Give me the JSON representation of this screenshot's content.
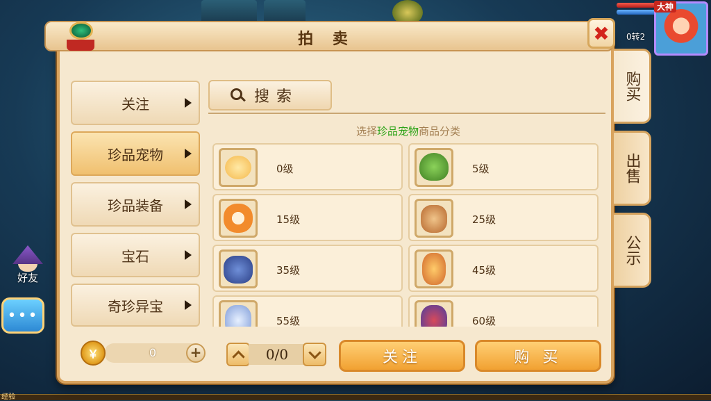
{
  "hud": {
    "avatar_badge": "大神",
    "level_text": "0转2"
  },
  "left_hud": {
    "friend_label": "好友",
    "chat_icon": "•••"
  },
  "bottom": {
    "exp_label": "经验"
  },
  "panel": {
    "title": "拍 卖",
    "close_icon": "✖"
  },
  "categories": [
    {
      "label": "关注"
    },
    {
      "label": "珍品宠物"
    },
    {
      "label": "珍品装备"
    },
    {
      "label": "宝石"
    },
    {
      "label": "奇珍异宝"
    }
  ],
  "search": {
    "label": "搜索"
  },
  "hint": {
    "prefix": "选择",
    "highlight": "珍品宠物",
    "suffix": "商品分类"
  },
  "pets": [
    {
      "level": "0级"
    },
    {
      "level": "5级"
    },
    {
      "level": "15级"
    },
    {
      "level": "25级"
    },
    {
      "level": "35级"
    },
    {
      "level": "45级"
    },
    {
      "level": "55级"
    },
    {
      "level": "60级"
    }
  ],
  "side_tabs": [
    {
      "label": "购买"
    },
    {
      "label": "出售"
    },
    {
      "label": "公示"
    }
  ],
  "footer": {
    "coin_icon": "￥",
    "coin_value": "0",
    "add_icon": "+",
    "page_text": "0/0",
    "follow_button": "关注",
    "buy_button": "购 买"
  },
  "colors": {
    "highlight_green": "#2ca318",
    "button_orange": "#f1a132",
    "close_red": "#d3241b"
  }
}
